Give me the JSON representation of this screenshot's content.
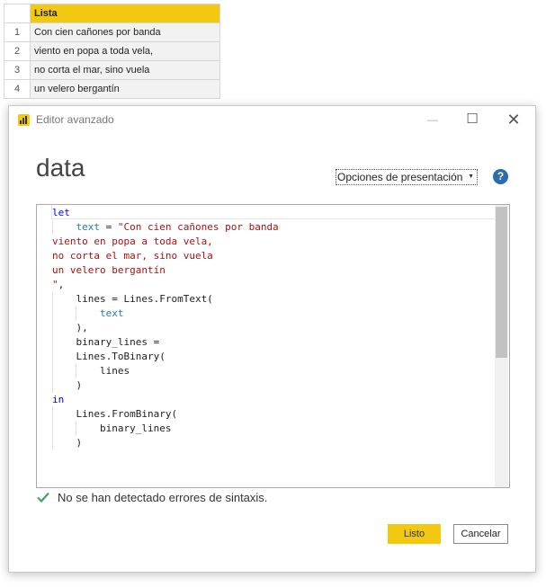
{
  "table": {
    "header": "Lista",
    "rows": [
      {
        "index": "1",
        "value": "Con cien cañones por banda"
      },
      {
        "index": "2",
        "value": "viento en popa a toda vela,"
      },
      {
        "index": "3",
        "value": "no corta el mar, sino vuela"
      },
      {
        "index": "4",
        "value": "un velero bergantín"
      }
    ]
  },
  "dialog": {
    "title": "Editor avanzado",
    "query_name": "data",
    "display_options": "Opciones de presentación",
    "help_icon": "question-circle-icon",
    "status": "No se han detectado errores de sintaxis.",
    "ok_label": "Listo",
    "cancel_label": "Cancelar"
  },
  "code": {
    "lines": [
      [
        [
          "kw",
          "let"
        ]
      ],
      [
        [
          "id",
          "    "
        ],
        [
          "var",
          "text"
        ],
        [
          "id",
          " = "
        ],
        [
          "str",
          "\"Con cien cañones por banda"
        ]
      ],
      [
        [
          "str",
          "viento en popa a toda vela,"
        ]
      ],
      [
        [
          "str",
          "no corta el mar, sino vuela"
        ]
      ],
      [
        [
          "str",
          "un velero bergantín"
        ]
      ],
      [
        [
          "str",
          "\""
        ],
        [
          "id",
          ","
        ]
      ],
      [
        [
          "id",
          "    lines = Lines.FromText("
        ]
      ],
      [
        [
          "id",
          "        "
        ],
        [
          "var",
          "text"
        ]
      ],
      [
        [
          "id",
          "    ),"
        ]
      ],
      [
        [
          "id",
          "    binary_lines ="
        ]
      ],
      [
        [
          "id",
          "    Lines.ToBinary("
        ]
      ],
      [
        [
          "id",
          "        lines"
        ]
      ],
      [
        [
          "id",
          "    )"
        ]
      ],
      [
        [
          "kw",
          "in"
        ]
      ],
      [
        [
          "id",
          "    Lines.FromBinary("
        ]
      ],
      [
        [
          "id",
          "        binary_lines"
        ]
      ],
      [
        [
          "id",
          "    )"
        ]
      ]
    ]
  },
  "colors": {
    "accent": "#f2c811",
    "keyword": "#0000ff",
    "string": "#a31515",
    "variable": "#267f99"
  }
}
